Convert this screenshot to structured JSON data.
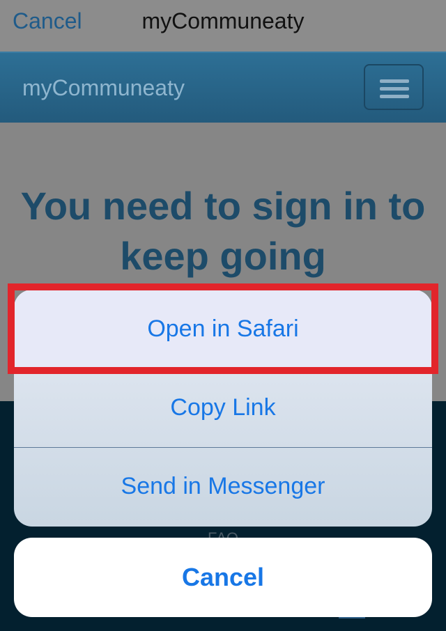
{
  "topbar": {
    "cancel_label": "Cancel",
    "title": "myCommuneaty"
  },
  "navbar": {
    "brand": "myCommuneaty",
    "menu_icon": "hamburger-menu-icon"
  },
  "page": {
    "headline": "You need to sign in to keep going",
    "footer_link": "FAQ"
  },
  "action_sheet": {
    "items": [
      {
        "label": "Open in Safari"
      },
      {
        "label": "Copy Link"
      },
      {
        "label": "Send in Messenger"
      }
    ],
    "cancel_label": "Cancel"
  },
  "colors": {
    "accent": "#1877e6",
    "navbar": "#2d6f95",
    "highlight": "#e2252b",
    "dark_footer": "#03202f"
  }
}
